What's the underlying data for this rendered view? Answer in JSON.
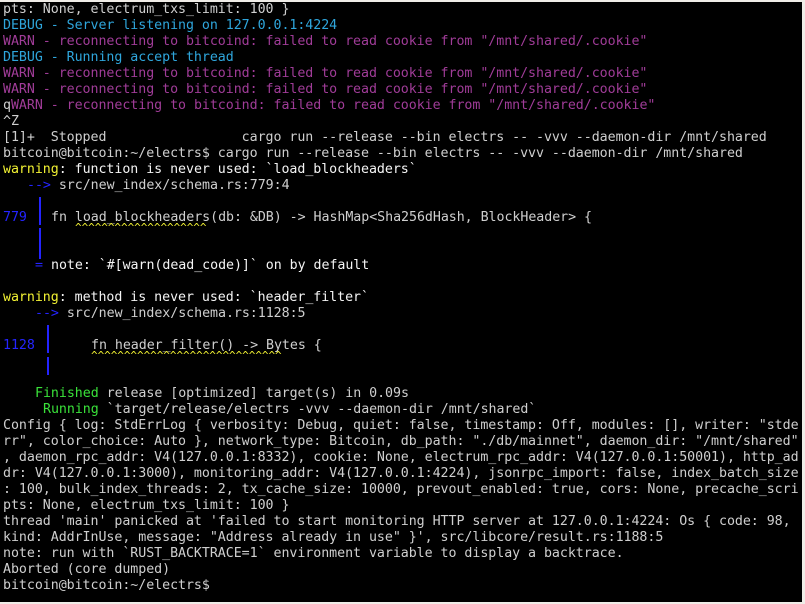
{
  "terminal": {
    "lines": [
      {
        "text": "pts: None, electrum_txs_limit: 100 }"
      },
      {
        "prefix": "DEBUG",
        "text": "DEBUG - Server listening on 127.0.0.1:4224"
      },
      {
        "prefix": "WARN",
        "text": "WARN - reconnecting to bitcoind: failed to read cookie from \"/mnt/shared/.cookie\""
      },
      {
        "prefix": "DEBUG",
        "text": "DEBUG - Running accept thread"
      },
      {
        "prefix": "WARN",
        "text": "WARN - reconnecting to bitcoind: failed to read cookie from \"/mnt/shared/.cookie\""
      },
      {
        "prefix": "WARN",
        "text": "WARN - reconnecting to bitcoind: failed to read cookie from \"/mnt/shared/.cookie\""
      },
      {
        "typed": "q",
        "prefix": "WARN",
        "text": "WARN - reconnecting to bitcoind: failed to read cookie from \"/mnt/shared/.cookie\""
      },
      {
        "text": "^Z"
      },
      {
        "text": "[1]+  Stopped                 cargo run --release --bin electrs -- -vvv --daemon-dir /mnt/shared"
      },
      {
        "prompt": "bitcoin@bitcoin:~/electrs$",
        "command": " cargo run --release --bin electrs -- -vvv --daemon-dir /mnt/shared"
      }
    ],
    "warning1": {
      "label": "warning",
      "message": ": function is never used: `load_blockheaders`",
      "arrow": "-->",
      "location": " src/new_index/schema.rs:779:4",
      "line_no": "779",
      "code": "fn load_blockheaders(db: &DB) -> HashMap<Sha256dHash, BlockHeader> {",
      "carets": "^^^^^^^^^^^^^^^^^^^^",
      "note_marker": "=",
      "note": "note: `#[warn(dead_code)]` on by default"
    },
    "warning2": {
      "label": "warning",
      "message": ": method is never used: `header_filter`",
      "arrow": "-->",
      "location": " src/new_index/schema.rs:1128:5",
      "line_no": "1128",
      "code": "fn header_filter() -> Bytes {",
      "carets": "^^^^^^^^^^^^^^^^^^^^^^^^^^^^^"
    },
    "build": {
      "finished_label": "Finished",
      "finished_text": " release [optimized] target(s) in 0.09s",
      "running_label": "Running",
      "running_text": " `target/release/electrs -vvv --daemon-dir /mnt/shared`"
    },
    "tail_lines": [
      "Config { log: StdErrLog { verbosity: Debug, quiet: false, timestamp: Off, modules: [], writer: \"stde",
      "rr\", color_choice: Auto }, network_type: Bitcoin, db_path: \"./db/mainnet\", daemon_dir: \"/mnt/shared\"",
      ", daemon_rpc_addr: V4(127.0.0.1:8332), cookie: None, electrum_rpc_addr: V4(127.0.0.1:50001), http_ad",
      "dr: V4(127.0.0.1:3000), monitoring_addr: V4(127.0.0.1:4224), jsonrpc_import: false, index_batch_size",
      ": 100, bulk_index_threads: 2, tx_cache_size: 10000, prevout_enabled: true, cors: None, precache_scri",
      "pts: None, electrum_txs_limit: 100 }",
      "thread 'main' panicked at 'failed to start monitoring HTTP server at 127.0.0.1:4224: Os { code: 98,",
      "kind: AddrInUse, message: \"Address already in use\" }', src/libcore/result.rs:1188:5",
      "note: run with `RUST_BACKTRACE=1` environment variable to display a backtrace.",
      "Aborted (core dumped)"
    ],
    "final_prompt": "bitcoin@bitcoin:~/electrs$",
    "colors": {
      "background": "#000000",
      "text": "#cfcfcf",
      "debug": "#2fa6dc",
      "warn": "#a03c98",
      "warning": "#f2f233",
      "gutter": "#2424ff",
      "success": "#3ae23a"
    }
  }
}
